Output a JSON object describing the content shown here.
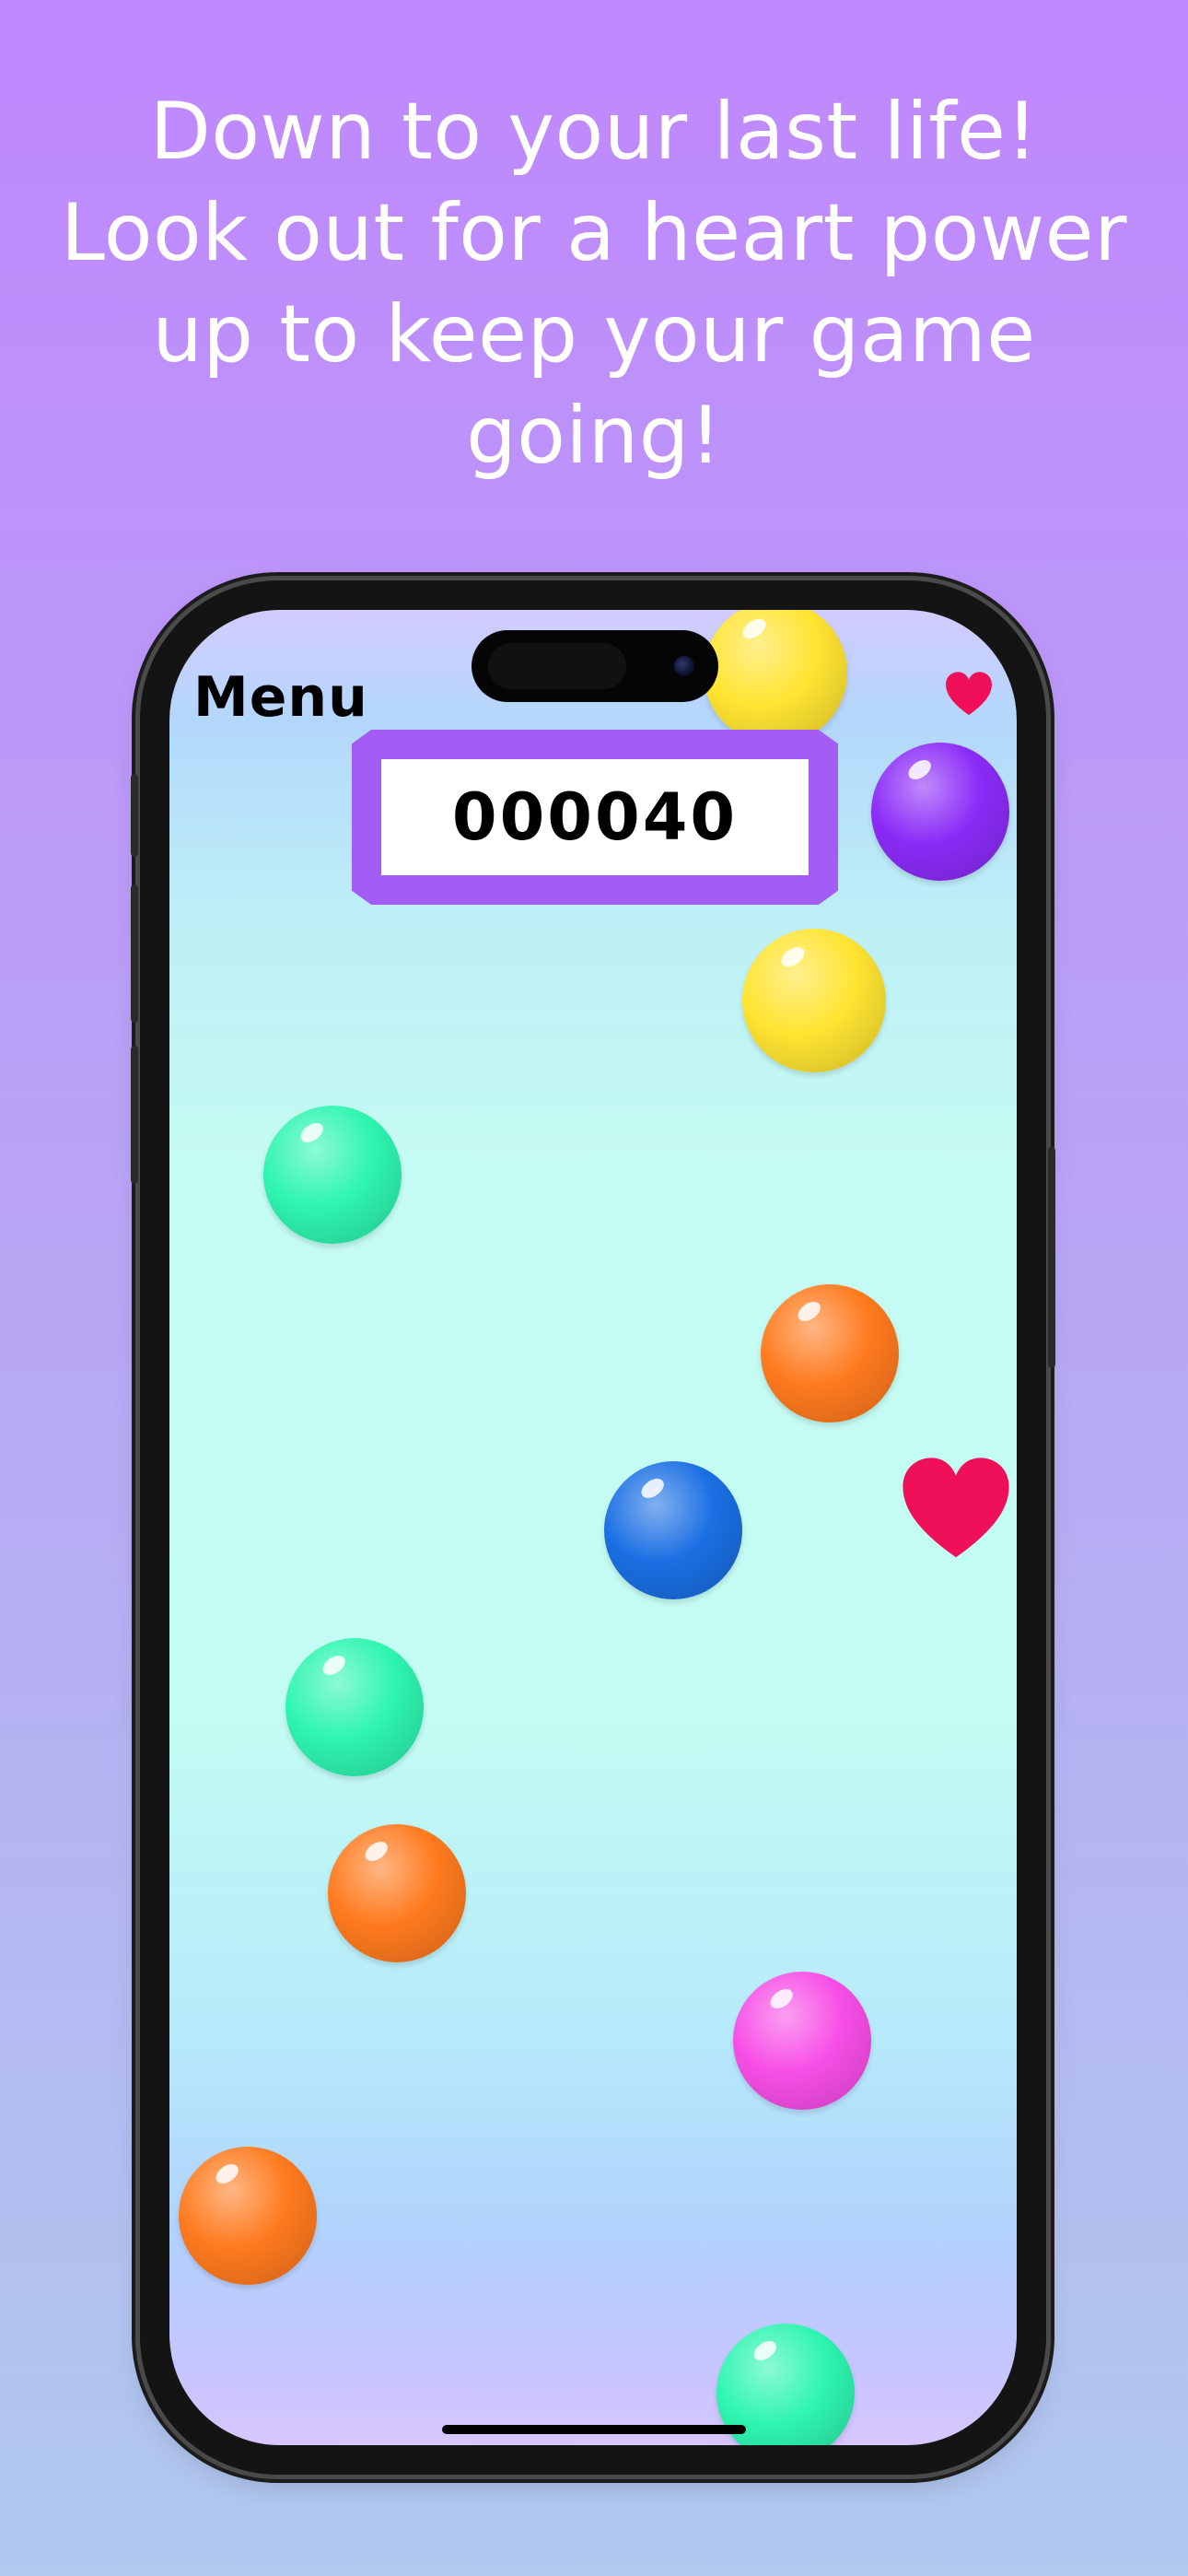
{
  "promo": {
    "headline_lines": [
      "Down to your last life!",
      "Look out for a heart power",
      "up to keep your game",
      "going!"
    ]
  },
  "game": {
    "menu_label": "Menu",
    "score": "000040",
    "lives_remaining": 1,
    "colors": {
      "score_frame": "#a35df5",
      "heart": "#f0105a",
      "bubble_yellow": "#ffe431",
      "bubble_purple": "#8b2bf7",
      "bubble_mint": "#2ef5b0",
      "bubble_orange": "#ff7a1e",
      "bubble_blue": "#1a6fe3",
      "bubble_pink": "#f74ee6"
    },
    "bubbles": [
      {
        "color": "yellow"
      },
      {
        "color": "purple"
      },
      {
        "color": "yellow"
      },
      {
        "color": "mint"
      },
      {
        "color": "orange"
      },
      {
        "color": "blue"
      },
      {
        "color": "mint"
      },
      {
        "color": "orange"
      },
      {
        "color": "pink"
      },
      {
        "color": "orange"
      },
      {
        "color": "mint"
      }
    ],
    "powerup": {
      "type": "heart",
      "icon": "heart-icon"
    }
  }
}
